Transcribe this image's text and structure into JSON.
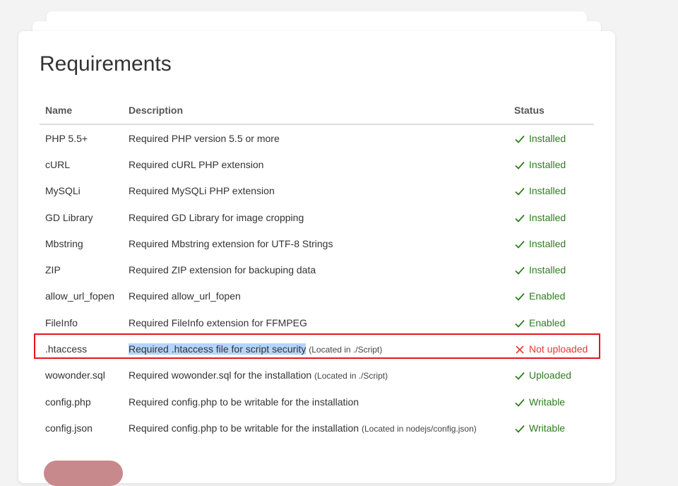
{
  "title": "Requirements",
  "table": {
    "headers": {
      "name": "Name",
      "description": "Description",
      "status": "Status"
    },
    "rows": [
      {
        "name": "PHP 5.5+",
        "description": "Required PHP version 5.5 or more",
        "note": "",
        "status": "Installed",
        "ok": true
      },
      {
        "name": "cURL",
        "description": "Required cURL PHP extension",
        "note": "",
        "status": "Installed",
        "ok": true
      },
      {
        "name": "MySQLi",
        "description": "Required MySQLi PHP extension",
        "note": "",
        "status": "Installed",
        "ok": true
      },
      {
        "name": "GD Library",
        "description": "Required GD Library for image cropping",
        "note": "",
        "status": "Installed",
        "ok": true
      },
      {
        "name": "Mbstring",
        "description": "Required Mbstring extension for UTF-8 Strings",
        "note": "",
        "status": "Installed",
        "ok": true
      },
      {
        "name": "ZIP",
        "description": "Required ZIP extension for backuping data",
        "note": "",
        "status": "Installed",
        "ok": true
      },
      {
        "name": "allow_url_fopen",
        "description": "Required allow_url_fopen",
        "note": "",
        "status": "Enabled",
        "ok": true
      },
      {
        "name": "FileInfo",
        "description": "Required FileInfo extension for FFMPEG",
        "note": "",
        "status": "Enabled",
        "ok": true
      },
      {
        "name": ".htaccess",
        "description": "Required .htaccess file for script security",
        "note": "(Located in ./Script)",
        "status": "Not uploaded",
        "ok": false,
        "highlighted": true
      },
      {
        "name": "wowonder.sql",
        "description": "Required wowonder.sql for the installation",
        "note": "(Located in ./Script)",
        "status": "Uploaded",
        "ok": true
      },
      {
        "name": "config.php",
        "description": "Required config.php to be writable for the installation",
        "note": "",
        "status": "Writable",
        "ok": true
      },
      {
        "name": "config.json",
        "description": "Required config.php to be writable for the installation",
        "note": "(Located in nodejs/config.json)",
        "status": "Writable",
        "ok": true
      }
    ]
  },
  "colors": {
    "ok": "#2e7d1f",
    "error": "#e53935",
    "highlight_box": "#e8141c",
    "selection": "#b4d5fe",
    "button": "#c8898c"
  },
  "icons": {
    "ok": "check-icon",
    "error": "x-icon"
  }
}
